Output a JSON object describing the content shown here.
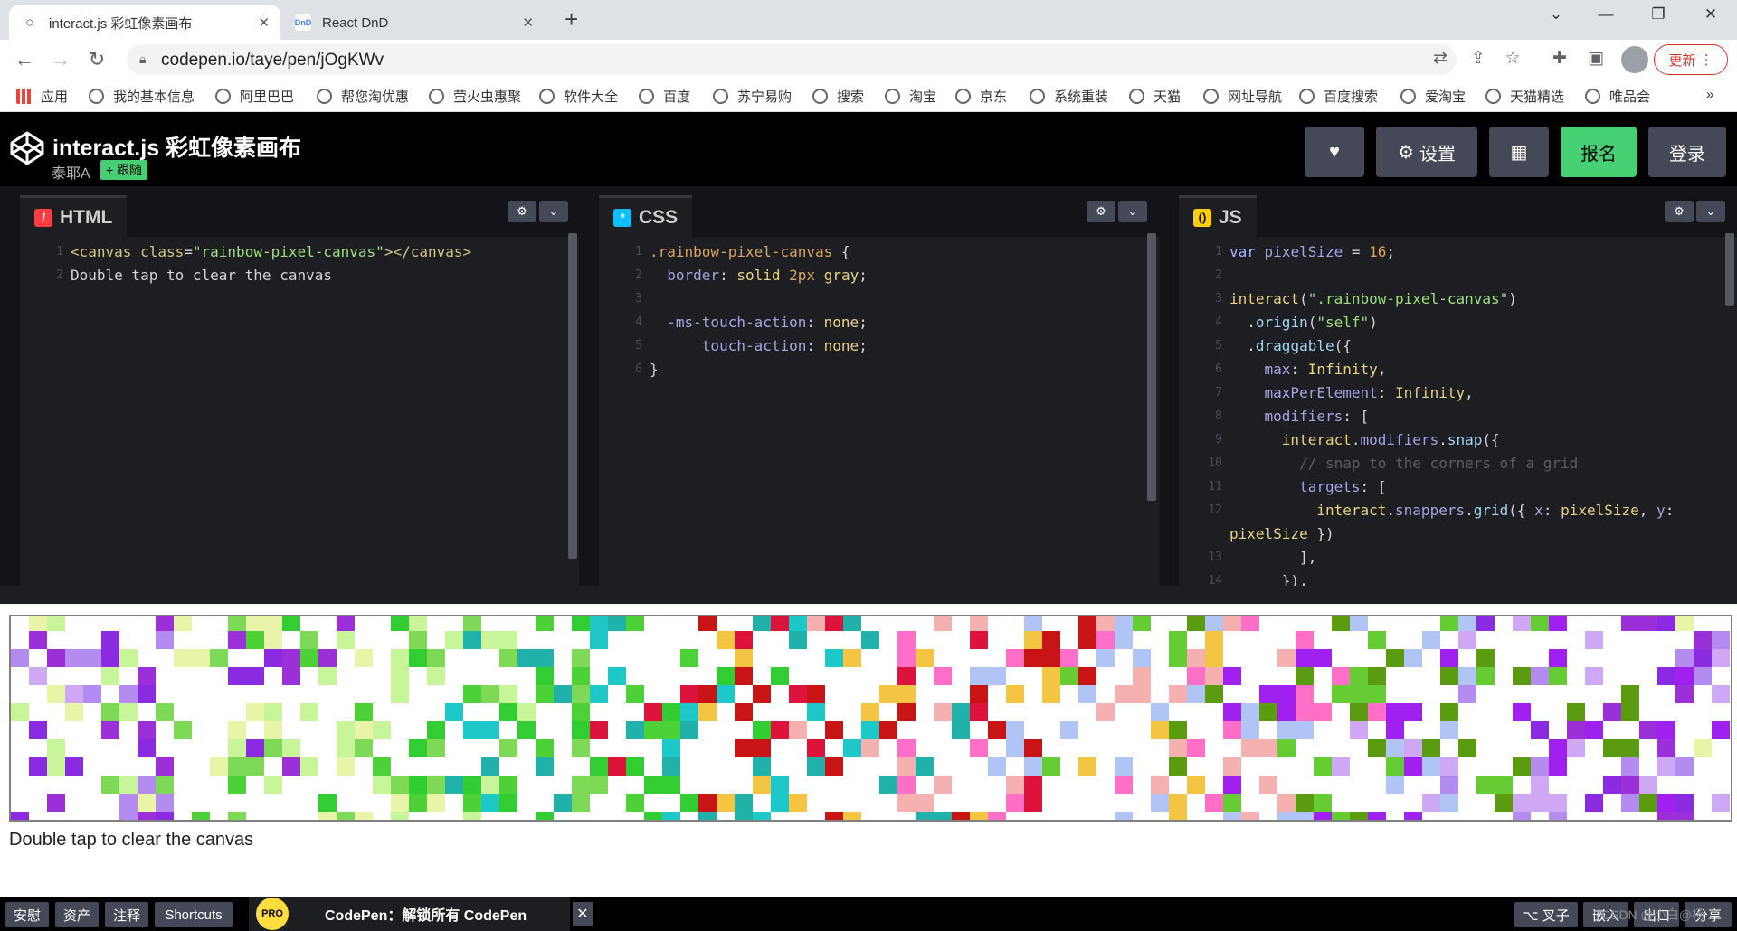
{
  "browser": {
    "tabs": [
      {
        "title": "interact.js 彩虹像素画布",
        "favicon": "codepen-icon",
        "active": true
      },
      {
        "title": "React DnD",
        "favicon": "dnd-icon",
        "active": false
      }
    ],
    "url": "codepen.io/taye/pen/jOgKWv",
    "update_label": "更新",
    "bookmarks": [
      "应用",
      "我的基本信息",
      "阿里巴巴",
      "帮您淘优惠",
      "萤火虫惠聚",
      "软件大全",
      "百度",
      "苏宁易购",
      "搜索",
      "淘宝",
      "京东",
      "系统重装",
      "天猫",
      "网址导航",
      "百度搜索",
      "爱淘宝",
      "天猫精选",
      "唯品会"
    ],
    "bookmarks_more": "»"
  },
  "header": {
    "title": "interact.js 彩虹像素画布",
    "author": "泰耶A",
    "follow_label": "+ 跟随",
    "settings_label": "设置",
    "signup_label": "报名",
    "login_label": "登录",
    "accent": "#47cf73"
  },
  "panels": {
    "html": {
      "label": "HTML",
      "icon_color": "#ff3c41"
    },
    "css": {
      "label": "CSS",
      "icon_color": "#0ebeff"
    },
    "js": {
      "label": "JS",
      "icon_color": "#fcd000"
    }
  },
  "preview": {
    "caption": "Double tap to clear the canvas"
  },
  "footer": {
    "buttons": [
      "安慰",
      "资产",
      "注释",
      "Shortcuts"
    ],
    "pro_badge": "PRO",
    "promo_text": "CodePen：解锁所有 CodePen",
    "right_buttons": [
      "⌥ 叉子",
      "嵌入",
      "出口",
      "分享"
    ],
    "watermark": "CSDN @小白@杨"
  }
}
